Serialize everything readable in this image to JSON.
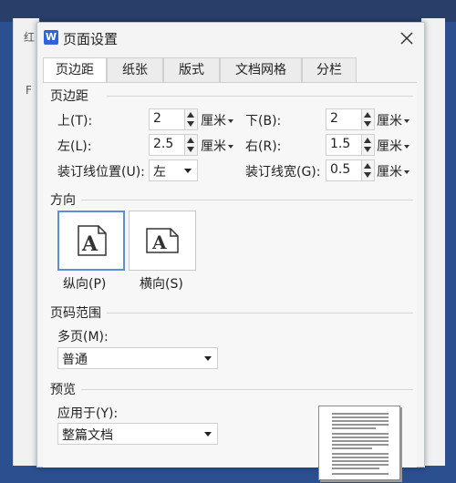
{
  "background": {
    "glyph_top": "红",
    "glyph_left": "F"
  },
  "dialog": {
    "title": "页面设置",
    "app_icon": "W",
    "tabs": [
      {
        "label": "页边距",
        "active": true
      },
      {
        "label": "纸张",
        "active": false
      },
      {
        "label": "版式",
        "active": false
      },
      {
        "label": "文档网格",
        "active": false
      },
      {
        "label": "分栏",
        "active": false
      }
    ]
  },
  "margins": {
    "section": "页边距",
    "top": {
      "label": "上(T):",
      "value": "2",
      "unit": "厘米"
    },
    "bottom": {
      "label": "下(B):",
      "value": "2",
      "unit": "厘米"
    },
    "left": {
      "label": "左(L):",
      "value": "2.5",
      "unit": "厘米"
    },
    "right": {
      "label": "右(R):",
      "value": "1.5",
      "unit": "厘米"
    },
    "gutter_pos": {
      "label": "装订线位置(U):",
      "value": "左"
    },
    "gutter_width": {
      "label": "装订线宽(G):",
      "value": "0.5",
      "unit": "厘米"
    }
  },
  "orientation": {
    "section": "方向",
    "portrait": "纵向(P)",
    "landscape": "横向(S)",
    "icon_letter": "A",
    "selected": "portrait"
  },
  "pages": {
    "section": "页码范围",
    "multiple_label": "多页(M):",
    "multiple_value": "普通"
  },
  "preview": {
    "section": "预览",
    "apply_label": "应用于(Y):",
    "apply_value": "整篇文档"
  },
  "colors": {
    "accent": "#5b8fd6",
    "app_icon_bg": "#2f64d6",
    "desktop": "#2b4f8f"
  },
  "icons": {
    "close": "close-icon",
    "app": "wps-writer-icon",
    "orientation": "document-a-icon"
  }
}
